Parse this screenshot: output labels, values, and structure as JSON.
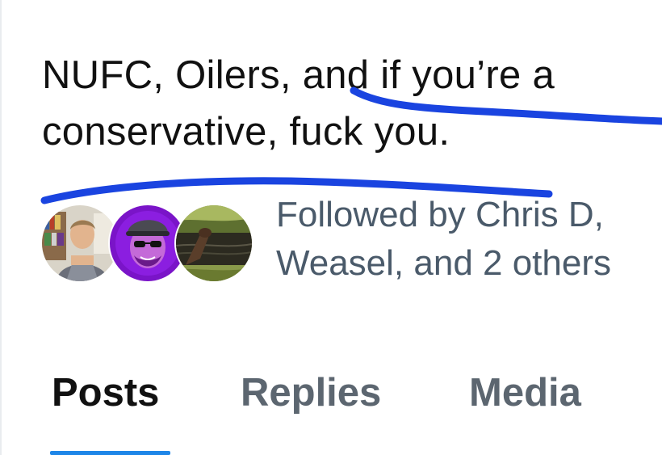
{
  "profile": {
    "bio_line1": "NUFC, Oilers, and if you’re a",
    "bio_line2": "conservative, fuck you."
  },
  "followers": {
    "avatars": [
      {
        "name": "avatar-person-bookshelf-icon"
      },
      {
        "name": "avatar-purple-cartoon-icon"
      },
      {
        "name": "avatar-animal-water-icon"
      }
    ],
    "line1": "Followed by Chris D,",
    "line2": "Weasel, and 2 others"
  },
  "tabs": {
    "posts": "Posts",
    "replies": "Replies",
    "media": "Media",
    "active": "Posts"
  },
  "colors": {
    "accent": "#1e86e8",
    "scribble": "#1a44e0",
    "text_primary": "#111111",
    "text_secondary": "#4a5a6a"
  }
}
